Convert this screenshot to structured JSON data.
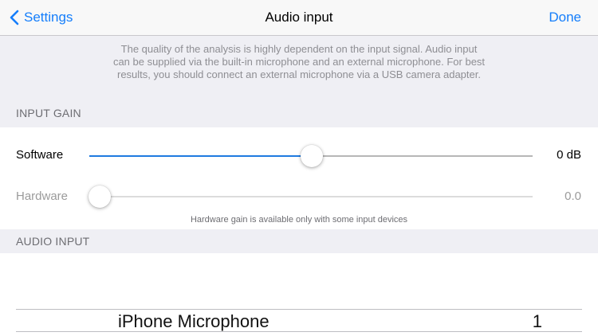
{
  "nav": {
    "back_label": "Settings",
    "title": "Audio input",
    "done_label": "Done"
  },
  "info_text": "The quality of the analysis is highly dependent on the input signal. Audio input can be supplied via the built-in microphone and an external microphone. For best results, you should connect an external microphone via a USB camera adapter.",
  "input_gain": {
    "header": "INPUT GAIN",
    "software": {
      "label": "Software",
      "value": "0 dB",
      "level": 0.5
    },
    "hardware": {
      "label": "Hardware",
      "value": "0.0",
      "level": 0.0,
      "enabled": false
    },
    "note": "Hardware gain is available only with some input devices"
  },
  "audio_input": {
    "header": "AUDIO INPUT",
    "picker": {
      "selected_name": "iPhone Microphone",
      "selected_channel": "1"
    }
  },
  "colors": {
    "accent": "#157efb",
    "slider_fill": "#1f7ae0",
    "disabled_text": "#9b9b9b"
  }
}
